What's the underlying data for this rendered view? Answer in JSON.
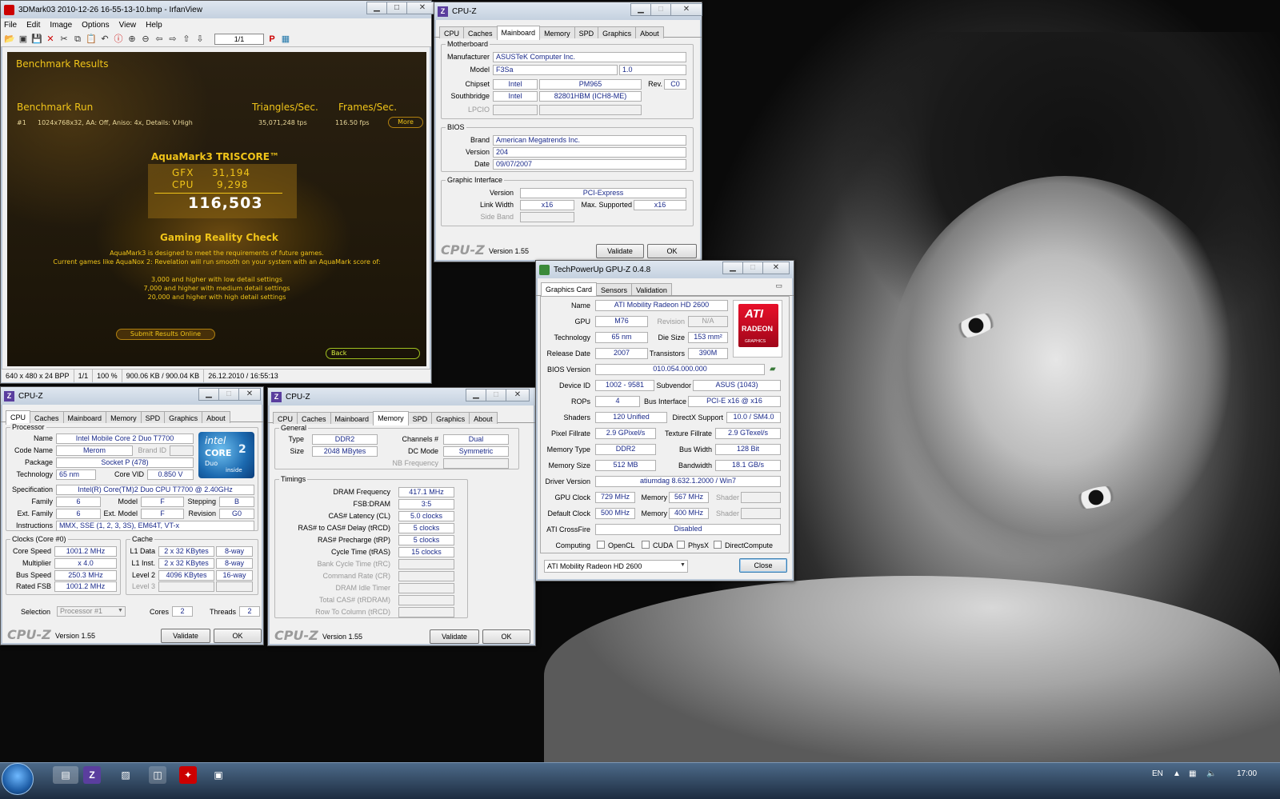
{
  "irfan": {
    "title": "3DMark03 2010-12-26 16-55-13-10.bmp - IrfanView",
    "menu": [
      "File",
      "Edit",
      "Image",
      "Options",
      "View",
      "Help"
    ],
    "page_counter": "1/1",
    "status": [
      "640 x 480 x 24 BPP",
      "1/1",
      "100 %",
      "900.06 KB / 900.04 KB",
      "26.12.2010 / 16:55:13"
    ],
    "aqua": {
      "results": "Benchmark Results",
      "run": "Benchmark Run",
      "tri": "Triangles/Sec.",
      "fps": "Frames/Sec.",
      "row_num": "#1",
      "row_desc": "1024x768x32, AA: Off, Aniso: 4x, Details: V.High",
      "row_tps": "35,071,248 tps",
      "row_fps": "116.50 fps",
      "more": "More",
      "triscore": "AquaMark3 TRISCORE™",
      "gfx_label": "GFX",
      "gfx": "31,194",
      "cpu_label": "CPU",
      "cpu": "9,298",
      "total": "116,503",
      "reality": "Gaming Reality Check",
      "desc1": "AquaMark3 is designed to meet the requirements of future games.",
      "desc2": "Current games like AquaNox 2: Revelation will run smooth on your system with an AquaMark score of:",
      "low": "3,000 and higher with low detail settings",
      "med": "7,000 and higher with medium detail settings",
      "high": "20,000 and higher with high detail settings",
      "submit": "Submit Results Online",
      "back": "Back"
    }
  },
  "cpuz_mb": {
    "title": "CPU-Z",
    "tabs": [
      "CPU",
      "Caches",
      "Mainboard",
      "Memory",
      "SPD",
      "Graphics",
      "About"
    ],
    "active": "Mainboard",
    "motherboard": "Motherboard",
    "manufacturer_l": "Manufacturer",
    "manufacturer": "ASUSTeK Computer Inc.",
    "model_l": "Model",
    "model": "F3Sa",
    "model_rev": "1.0",
    "chipset_l": "Chipset",
    "chipset_v": "Intel",
    "chipset": "PM965",
    "rev_l": "Rev.",
    "rev": "C0",
    "south_l": "Southbridge",
    "south_v": "Intel",
    "south": "82801HBM (ICH8-ME)",
    "lpcio_l": "LPCIO",
    "bios": "BIOS",
    "brand_l": "Brand",
    "brand": "American Megatrends Inc.",
    "version_l": "Version",
    "version": "204",
    "date_l": "Date",
    "date": "09/07/2007",
    "gi": "Graphic Interface",
    "giver_l": "Version",
    "giver": "PCI-Express",
    "lw_l": "Link Width",
    "lw": "x16",
    "ms_l": "Max. Supported",
    "ms": "x16",
    "sb_l": "Side Band",
    "logo": "CPU-Z",
    "ver": "Version 1.55",
    "validate": "Validate",
    "ok": "OK"
  },
  "cpuz_cpu": {
    "title": "CPU-Z",
    "tabs": [
      "CPU",
      "Caches",
      "Mainboard",
      "Memory",
      "SPD",
      "Graphics",
      "About"
    ],
    "active": "CPU",
    "processor": "Processor",
    "name_l": "Name",
    "name": "Intel Mobile Core 2 Duo T7700",
    "code_l": "Code Name",
    "code": "Merom",
    "brandid_l": "Brand ID",
    "pkg_l": "Package",
    "pkg": "Socket P (478)",
    "tech_l": "Technology",
    "tech": "65 nm",
    "vid_l": "Core VID",
    "vid": "0.850 V",
    "spec_l": "Specification",
    "spec": "Intel(R) Core(TM)2 Duo CPU    T7700  @ 2.40GHz",
    "fam_l": "Family",
    "fam": "6",
    "model_l": "Model",
    "model": "F",
    "step_l": "Stepping",
    "step": "B",
    "efam_l": "Ext. Family",
    "efam": "6",
    "emodel_l": "Ext. Model",
    "emodel": "F",
    "rev_l": "Revision",
    "rev": "G0",
    "instr_l": "Instructions",
    "instr": "MMX, SSE (1, 2, 3, 3S), EM64T, VT-x",
    "clocks": "Clocks (Core #0)",
    "cs_l": "Core Speed",
    "cs": "1001.2 MHz",
    "mul_l": "Multiplier",
    "mul": "x 4.0",
    "bs_l": "Bus Speed",
    "bs": "250.3 MHz",
    "fsb_l": "Rated FSB",
    "fsb": "1001.2 MHz",
    "cache": "Cache",
    "l1d_l": "L1 Data",
    "l1d": "2 x 32 KBytes",
    "l1d_w": "8-way",
    "l1i_l": "L1 Inst.",
    "l1i": "2 x 32 KBytes",
    "l1i_w": "8-way",
    "l2_l": "Level 2",
    "l2": "4096 KBytes",
    "l2_w": "16-way",
    "l3_l": "Level 3",
    "sel_l": "Selection",
    "sel": "Processor #1",
    "cores_l": "Cores",
    "cores": "2",
    "threads_l": "Threads",
    "threads": "2",
    "badge_intel": "intel",
    "badge_core": "CORE",
    "badge_2": "2",
    "badge_duo": "Duo",
    "badge_inside": "inside",
    "logo": "CPU-Z",
    "ver": "Version 1.55",
    "validate": "Validate",
    "ok": "OK"
  },
  "cpuz_mem": {
    "title": "CPU-Z",
    "tabs": [
      "CPU",
      "Caches",
      "Mainboard",
      "Memory",
      "SPD",
      "Graphics",
      "About"
    ],
    "active": "Memory",
    "general": "General",
    "type_l": "Type",
    "type": "DDR2",
    "size_l": "Size",
    "size": "2048 MBytes",
    "ch_l": "Channels #",
    "ch": "Dual",
    "dc_l": "DC Mode",
    "dc": "Symmetric",
    "nb_l": "NB Frequency",
    "timings": "Timings",
    "dram_l": "DRAM Frequency",
    "dram": "417.1 MHz",
    "fsbdram_l": "FSB:DRAM",
    "fsbdram": "3:5",
    "cl_l": "CAS# Latency (CL)",
    "cl": "5.0 clocks",
    "trcd_l": "RAS# to CAS# Delay (tRCD)",
    "trcd": "5 clocks",
    "trp_l": "RAS# Precharge (tRP)",
    "trp": "5 clocks",
    "tras_l": "Cycle Time (tRAS)",
    "tras": "15 clocks",
    "trc_l": "Bank Cycle Time (tRC)",
    "cr_l": "Command Rate (CR)",
    "idle_l": "DRAM Idle Timer",
    "trdram_l": "Total CAS# (tRDRAM)",
    "trcd2_l": "Row To Column (tRCD)",
    "logo": "CPU-Z",
    "ver": "Version 1.55",
    "validate": "Validate",
    "ok": "OK"
  },
  "gpuz": {
    "title": "TechPowerUp GPU-Z 0.4.8",
    "tabs": [
      "Graphics Card",
      "Sensors",
      "Validation"
    ],
    "name_l": "Name",
    "name": "ATI Mobility Radeon HD 2600",
    "gpu_l": "GPU",
    "gpu": "M76",
    "rev_l": "Revision",
    "rev": "N/A",
    "tech_l": "Technology",
    "tech": "65 nm",
    "die_l": "Die Size",
    "die": "153 mm²",
    "rel_l": "Release Date",
    "rel": "2007",
    "tr_l": "Transistors",
    "tr": "390M",
    "bios_l": "BIOS Version",
    "bios": "010.054.000.000",
    "dev_l": "Device ID",
    "dev": "1002 - 9581",
    "sub_l": "Subvendor",
    "sub": "ASUS (1043)",
    "rops_l": "ROPs",
    "rops": "4",
    "bus_l": "Bus Interface",
    "bus": "PCI-E x16 @ x16",
    "sh_l": "Shaders",
    "sh": "120 Unified",
    "dx_l": "DirectX Support",
    "dx": "10.0 / SM4.0",
    "pf_l": "Pixel Fillrate",
    "pf": "2.9 GPixel/s",
    "tf_l": "Texture Fillrate",
    "tf": "2.9 GTexel/s",
    "mt_l": "Memory Type",
    "mt": "DDR2",
    "bw_l": "Bus Width",
    "bw": "128 Bit",
    "ms_l": "Memory Size",
    "ms": "512 MB",
    "band_l": "Bandwidth",
    "band": "18.1 GB/s",
    "drv_l": "Driver Version",
    "drv": "atiumdag 8.632.1.2000 / Win7",
    "gc_l": "GPU Clock",
    "gc": "729 MHz",
    "mem_l": "Memory",
    "mem": "567 MHz",
    "shd_l": "Shader",
    "dc_l": "Default Clock",
    "dc": "500 MHz",
    "dmem": "400 MHz",
    "cf_l": "ATI CrossFire",
    "cf": "Disabled",
    "comp_l": "Computing",
    "opencl": "OpenCL",
    "cuda": "CUDA",
    "physx": "PhysX",
    "dcompute": "DirectCompute",
    "select": "ATI Mobility Radeon HD 2600",
    "close": "Close",
    "ati": "ATI",
    "radeon": "RADEON",
    "graphics": "GRAPHICS"
  },
  "taskbar": {
    "lang": "EN",
    "time": "17:00"
  }
}
